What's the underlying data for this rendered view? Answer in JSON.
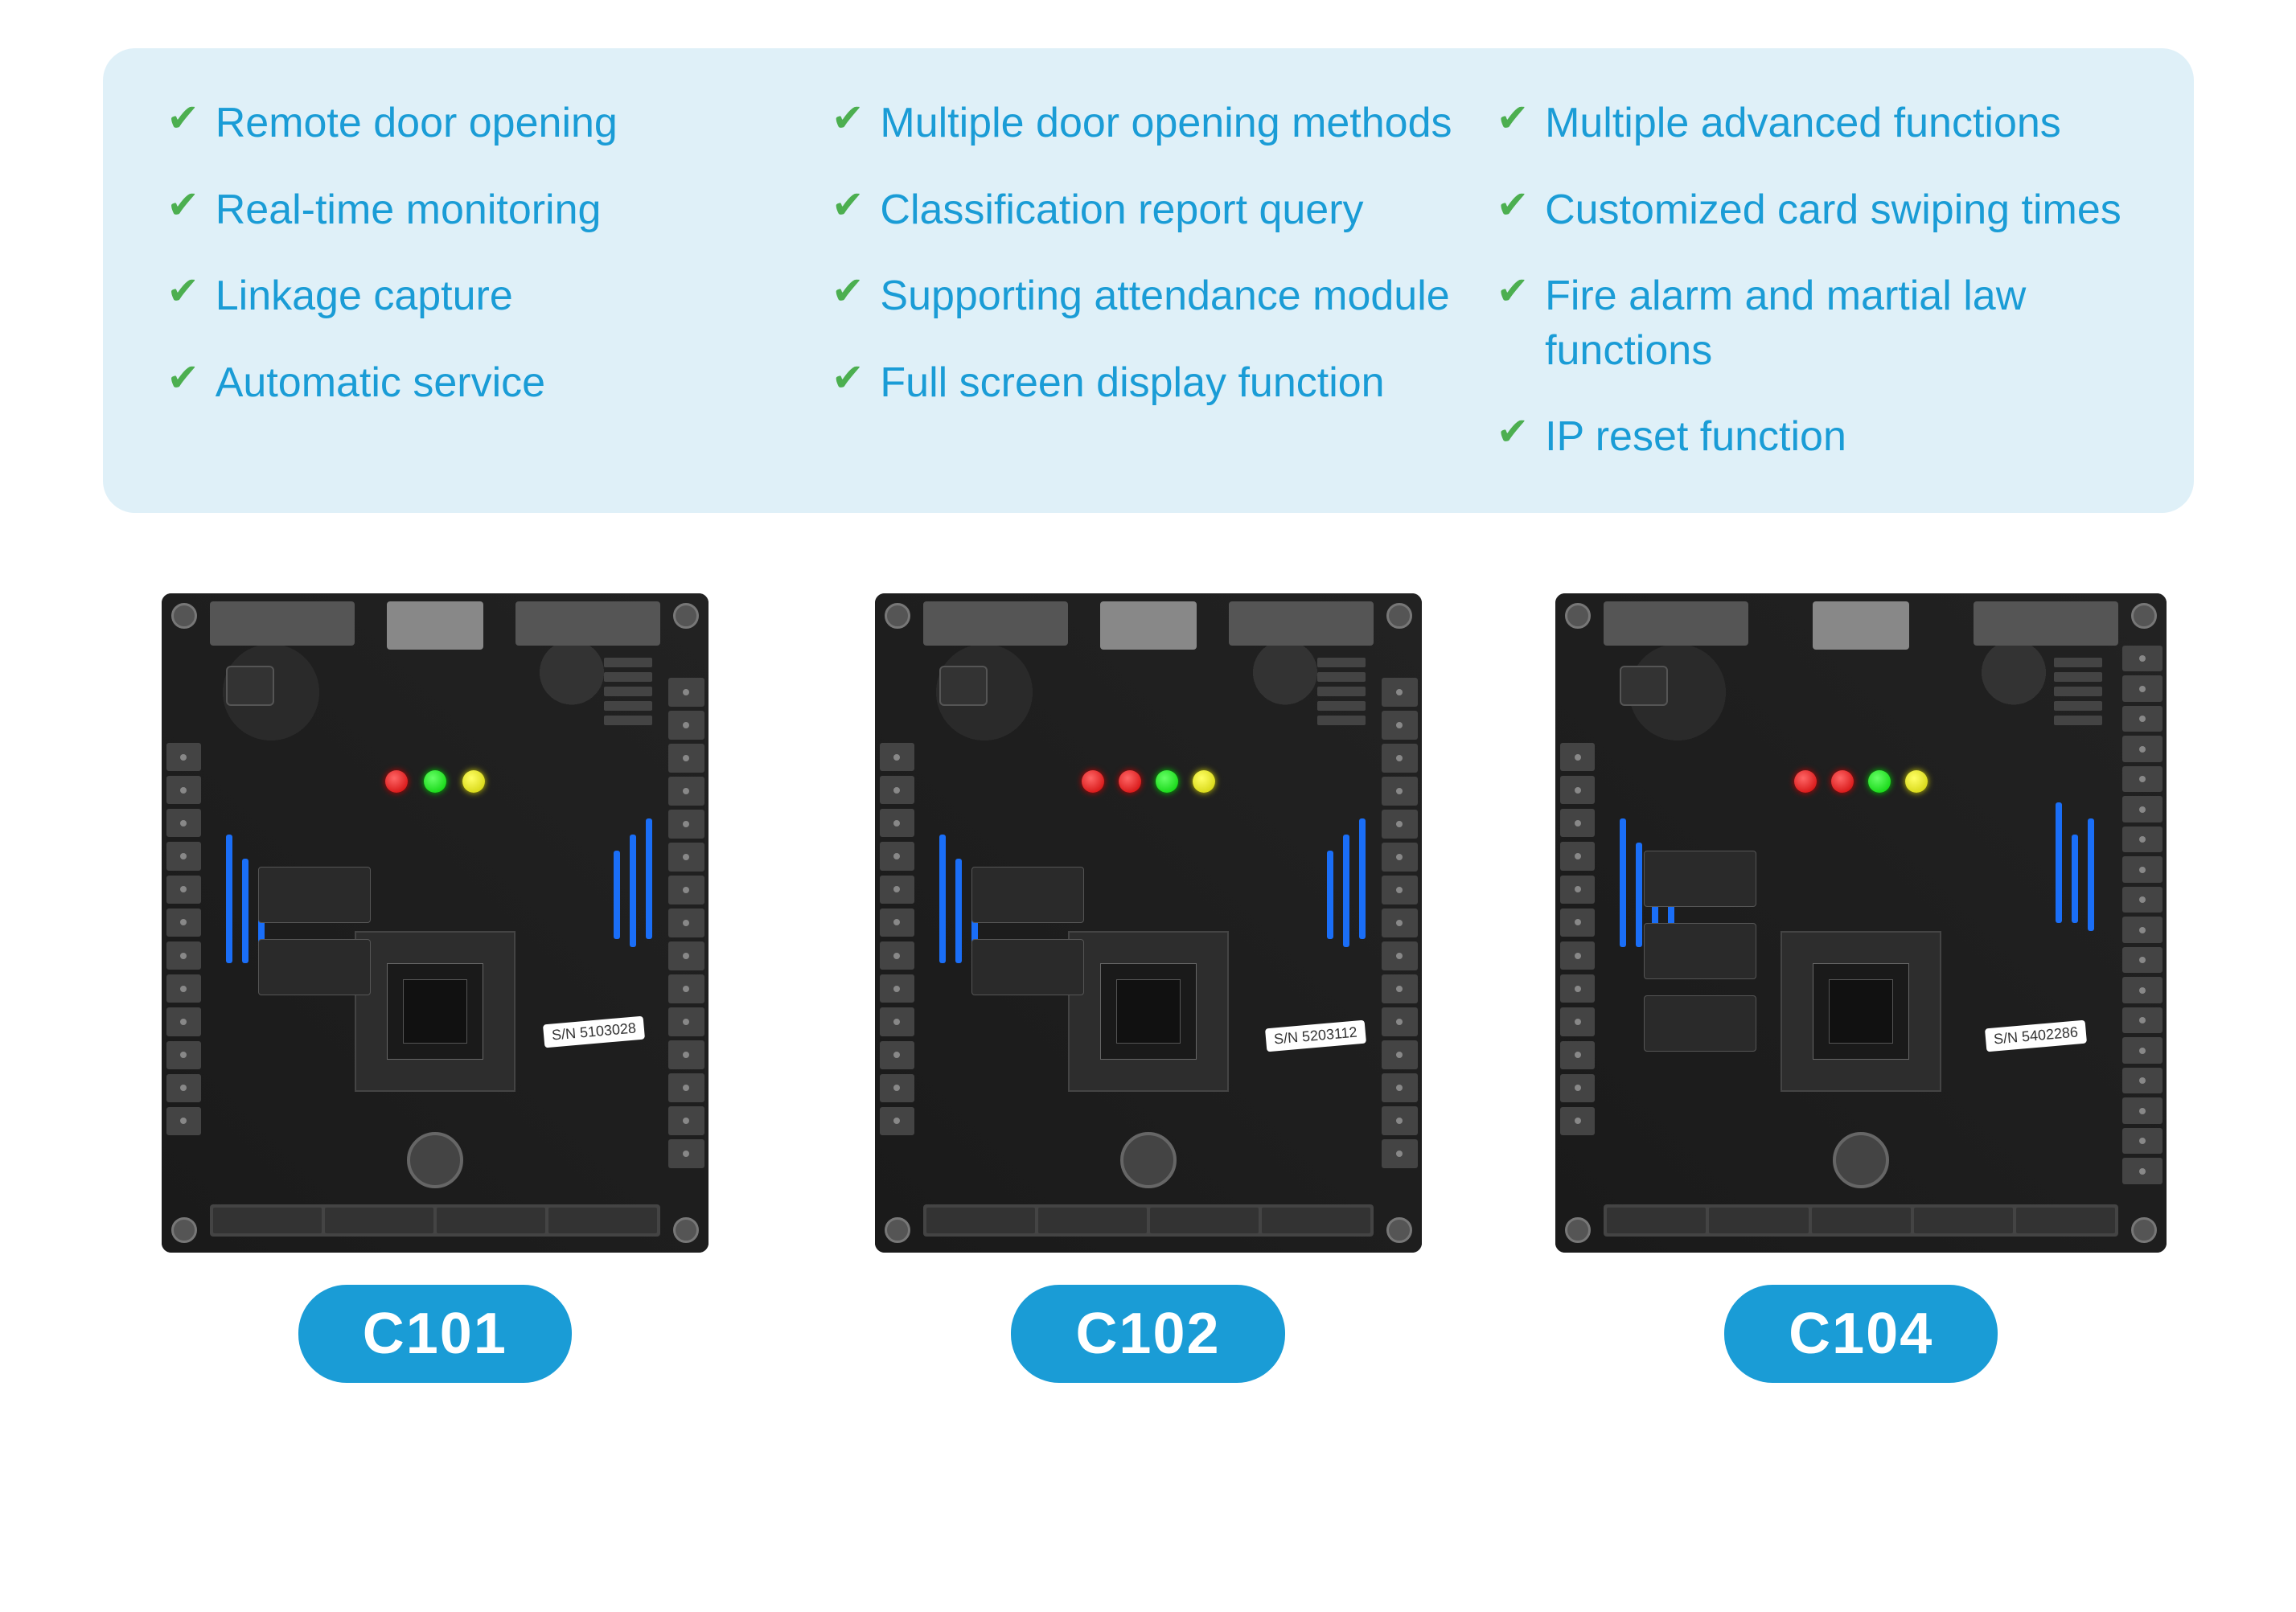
{
  "features": {
    "columns": [
      {
        "items": [
          {
            "text": "Remote door opening"
          },
          {
            "text": "Real-time monitoring"
          },
          {
            "text": "Linkage capture"
          },
          {
            "text": "Automatic service"
          }
        ]
      },
      {
        "items": [
          {
            "text": "Multiple door opening methods"
          },
          {
            "text": "Classification report query"
          },
          {
            "text": "Supporting attendance module"
          },
          {
            "text": "Full screen display function"
          }
        ]
      },
      {
        "items": [
          {
            "text": "Multiple advanced functions"
          },
          {
            "text": "Customized card swiping times"
          },
          {
            "text": "Fire alarm and martial law functions"
          },
          {
            "text": "IP reset function"
          }
        ]
      }
    ]
  },
  "products": [
    {
      "id": "c101",
      "label": "C101",
      "serial": "S/N 5103028",
      "leds": [
        "red",
        "green",
        "yellow"
      ]
    },
    {
      "id": "c102",
      "label": "C102",
      "serial": "S/N 5203112",
      "leds": [
        "red",
        "green",
        "yellow"
      ]
    },
    {
      "id": "c104",
      "label": "C104",
      "serial": "S/N 5402286",
      "leds": [
        "red",
        "green",
        "yellow"
      ]
    }
  ],
  "colors": {
    "check": "#4caf50",
    "feature_text": "#1a9cd6",
    "bg": "#dff0f8",
    "badge_bg": "#1a9cd6",
    "badge_text": "#ffffff",
    "board_bg": "#1a1a1a"
  }
}
